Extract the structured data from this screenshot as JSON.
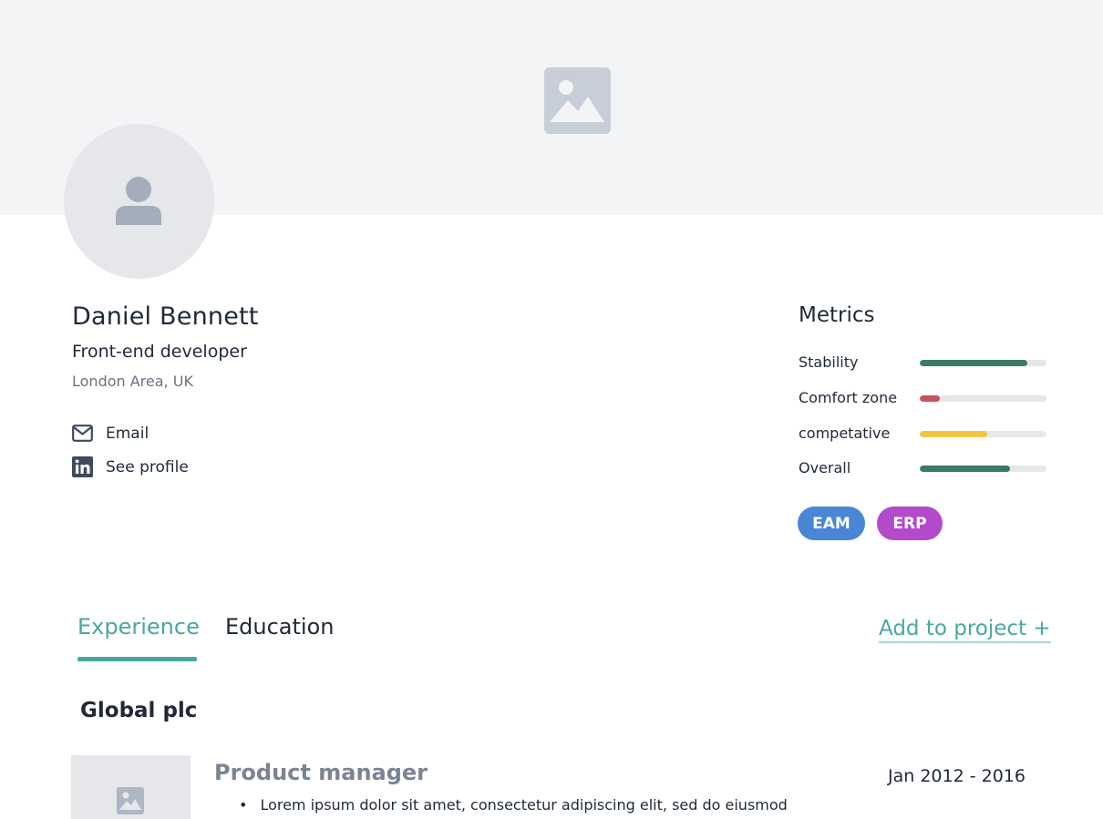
{
  "profile": {
    "name": "Daniel Bennett",
    "role": "Front-end developer",
    "location": "London Area, UK"
  },
  "contacts": {
    "email_label": "Email",
    "profile_label": "See profile"
  },
  "metrics": {
    "title": "Metrics",
    "items": [
      {
        "label": "Stability",
        "value": 0.85,
        "color": "#3b7a67"
      },
      {
        "label": "Comfort zone",
        "value": 0.16,
        "color": "#c9535d"
      },
      {
        "label": "competative",
        "value": 0.53,
        "color": "#eec643"
      },
      {
        "label": "Overall",
        "value": 0.71,
        "color": "#3b7a67"
      }
    ]
  },
  "tags": [
    {
      "label": "EAM",
      "color": "#4a86d6"
    },
    {
      "label": "ERP",
      "color": "#b34acb"
    }
  ],
  "tabs": {
    "experience": "Experience",
    "education": "Education",
    "active": "Experience"
  },
  "actions": {
    "add_to_project": "Add to project +"
  },
  "experience": {
    "company": "Global plc",
    "job_title": "Product manager",
    "dates": "Jan 2012 - 2016",
    "description": "Lorem ipsum dolor sit amet, consectetur adipiscing elit, sed do eiusmod"
  },
  "colors": {
    "accent": "#4aa79f",
    "banner_bg": "#f3f4f6",
    "placeholder_icon": "#c7ced8"
  }
}
